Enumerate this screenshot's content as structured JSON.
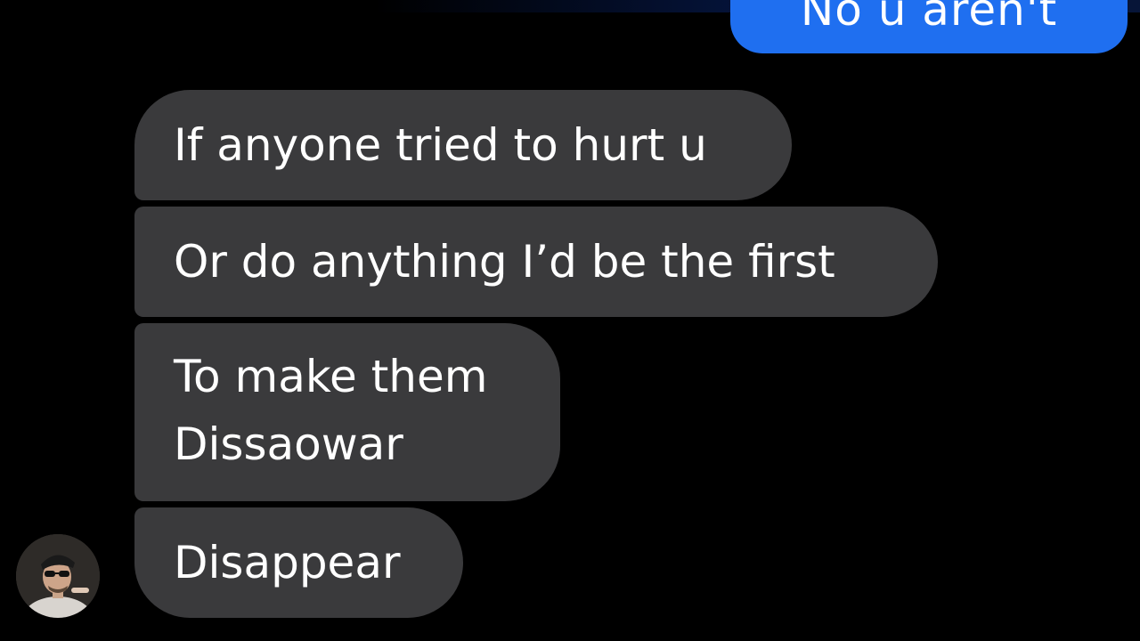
{
  "thread": {
    "sent_partial": "No u aren't",
    "messages": [
      {
        "lines": [
          "If anyone tried to hurt u"
        ]
      },
      {
        "lines": [
          "Or do anything I’d be the first"
        ]
      },
      {
        "lines": [
          "To make them",
          "Dissaowar"
        ]
      },
      {
        "lines": [
          "Disappear"
        ]
      }
    ]
  },
  "avatar": {
    "icon": "user-avatar-photo"
  },
  "colors": {
    "background": "#000000",
    "received_bubble": "#3a3a3c",
    "sent_bubble": "#1f6ff0",
    "text": "#ffffff"
  }
}
